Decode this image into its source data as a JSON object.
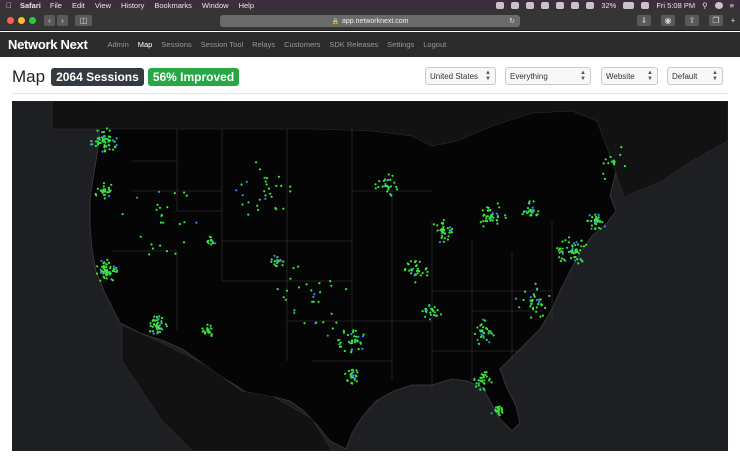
{
  "menubar": {
    "app_name": "Safari",
    "items": [
      "File",
      "Edit",
      "View",
      "History",
      "Bookmarks",
      "Window",
      "Help"
    ],
    "battery": "32%",
    "clock": "Fri 5:08 PM"
  },
  "browser": {
    "url": "app.networknext.com"
  },
  "app": {
    "logo": "Network Next",
    "nav": [
      "Admin",
      "Map",
      "Sessions",
      "Session Tool",
      "Relays",
      "Customers",
      "SDK Releases",
      "Settings",
      "Logout"
    ],
    "active_nav": "Map"
  },
  "page": {
    "title": "Map",
    "sessions_badge": "2064 Sessions",
    "improved_badge": "56% Improved",
    "colors": {
      "improved": "#28a745",
      "sessions": "#343a40",
      "direct_dot": "#2f8cff",
      "nn_dot": "#39e639"
    }
  },
  "filters": {
    "country": "United States",
    "scope": "Everything",
    "platform": "Website",
    "view": "Default"
  },
  "map": {
    "region": "United States",
    "legend": []
  }
}
